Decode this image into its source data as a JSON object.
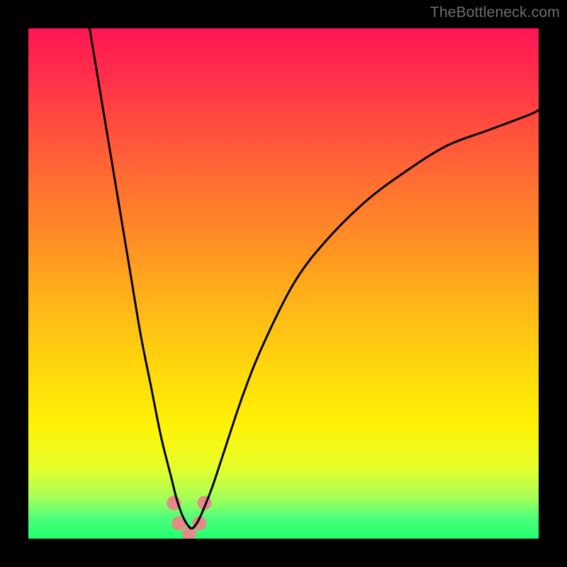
{
  "watermark": "TheBottleneck.com",
  "chart_data": {
    "type": "line",
    "title": "",
    "xlabel": "",
    "ylabel": "",
    "xlim": [
      0,
      100
    ],
    "ylim": [
      0,
      100
    ],
    "grid": false,
    "legend": false,
    "series": [
      {
        "name": "bottleneck-curve",
        "color": "#000000",
        "x": [
          12,
          14,
          16,
          18,
          20,
          22,
          24,
          26,
          28,
          29,
          30,
          31,
          32,
          33,
          34,
          36,
          38,
          42,
          46,
          52,
          58,
          66,
          74,
          82,
          90,
          98,
          100
        ],
        "y": [
          100,
          88,
          76,
          64,
          52,
          40,
          30,
          20,
          12,
          8,
          5,
          3,
          2,
          3,
          5,
          10,
          16,
          28,
          38,
          50,
          58,
          66,
          72,
          77,
          80,
          83,
          84
        ]
      }
    ],
    "markers": [
      {
        "name": "curve-marker",
        "x": 28.5,
        "y": 7,
        "color": "#e58b87",
        "r": 10
      },
      {
        "name": "curve-marker",
        "x": 29.5,
        "y": 3,
        "color": "#e58b87",
        "r": 10
      },
      {
        "name": "curve-marker",
        "x": 31.5,
        "y": 1,
        "color": "#e58b87",
        "r": 10
      },
      {
        "name": "curve-marker",
        "x": 33.5,
        "y": 3,
        "color": "#e58b87",
        "r": 10
      },
      {
        "name": "curve-marker",
        "x": 34.5,
        "y": 7,
        "color": "#e58b87",
        "r": 10
      }
    ],
    "annotations": []
  }
}
